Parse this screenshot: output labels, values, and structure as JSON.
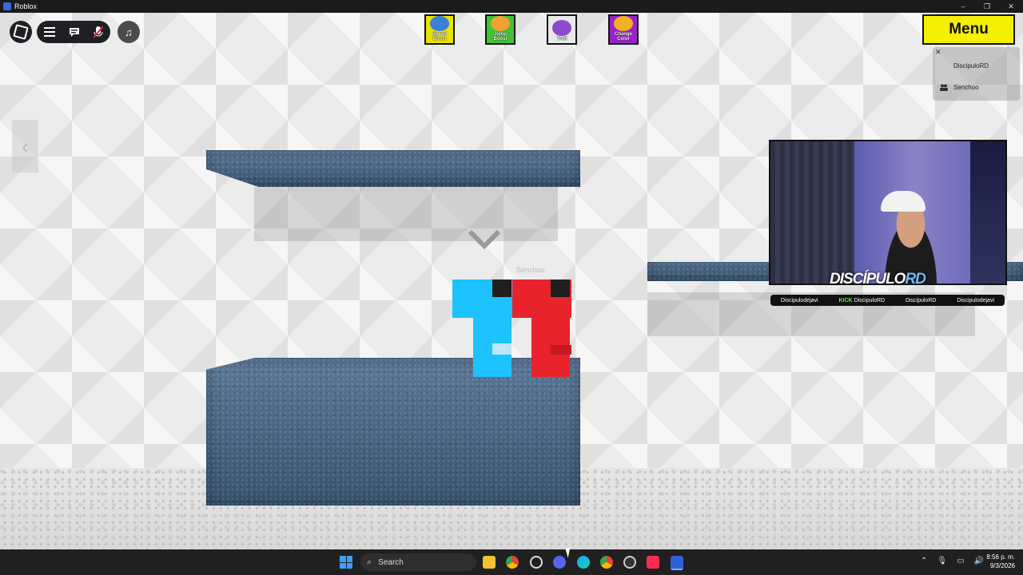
{
  "window": {
    "title": "Roblox",
    "controls": [
      "–",
      "❐",
      "✕"
    ]
  },
  "topbar": {
    "music_glyph": "♫"
  },
  "powerups": [
    {
      "label": "Speed Boost",
      "bg": "#e7e400",
      "pic": "#3a7fd8",
      "icon": "shoe-icon"
    },
    {
      "label": "Jump Boost",
      "bg": "#3fc432",
      "pic": "#f2a032",
      "icon": "jumper-icon"
    },
    {
      "label": "Troll",
      "bg": "#e9e9e9",
      "pic": "#8a4bd1",
      "icon": "troll-face-icon"
    },
    {
      "label": "Change Color",
      "bg": "#9b21c9",
      "pic": "#f0b21e",
      "icon": "color-wheel-icon"
    }
  ],
  "menu": {
    "label": "Menu"
  },
  "players": {
    "close": "✕",
    "list": [
      "DiscipuloRD",
      "Senchoo"
    ]
  },
  "nametag": "Senchoo",
  "stream": {
    "brand_main": "DISCÍPULO",
    "brand_accent": "RD",
    "socials": [
      "Discipulodejavi",
      "KICK",
      "DiscipuloRD",
      "DiscipuloRD",
      "Discipulodejavi"
    ]
  },
  "taskbar": {
    "search_placeholder": "Search",
    "time": "8:56 p. m.",
    "date": "9/3/2026"
  }
}
